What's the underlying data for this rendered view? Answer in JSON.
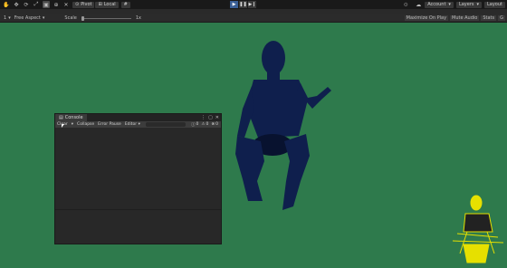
{
  "toolbar": {
    "pivot_label": "Pivot",
    "local_label": "Local",
    "account_label": "Account",
    "layers_label": "Layers",
    "layout_label": "Layout"
  },
  "game_view": {
    "display_label": "1",
    "aspect_label": "Free Aspect",
    "scale_label": "Scale",
    "scale_value": "1x",
    "maximize_label": "Maximize On Play",
    "mute_label": "Mute Audio",
    "stats_label": "Stats",
    "gizmos_label": "G"
  },
  "console": {
    "tab_label": "Console",
    "clear_label": "Clear",
    "collapse_label": "Collapse",
    "error_pause_label": "Error Pause",
    "editor_label": "Editor",
    "log_count": "0",
    "warning_count": "0",
    "error_count": "0"
  },
  "colors": {
    "scene_background": "#2e7a4c",
    "character": "#0f1f4d",
    "gizmo_character": "#e6e000"
  }
}
